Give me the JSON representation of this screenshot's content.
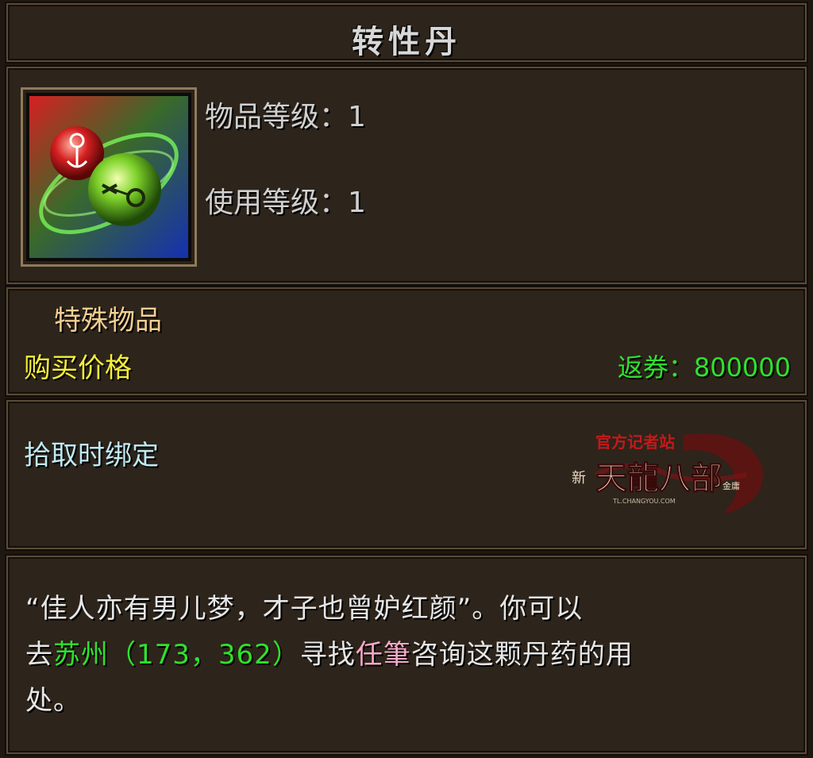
{
  "item": {
    "name": "转性丹",
    "item_level_label": "物品等级：",
    "item_level": "1",
    "use_level_label": "使用等级：",
    "use_level": "1",
    "item_type": "特殊物品",
    "price_label": "购买价格",
    "currency_label": "返券：",
    "currency_value": "800000",
    "bind_text": "拾取时绑定",
    "icon": "gender-swap-pill-icon"
  },
  "description": {
    "line1": "“佳人亦有男儿梦，才子也曾妒红颜”。你可以",
    "line2_pre": "去",
    "location": "苏州",
    "coords_open": "（",
    "coord_x": "173",
    "coord_sep": "，",
    "coord_y": "362",
    "coords_close": "）",
    "line2_mid": "寻找",
    "npc": "任筆",
    "line2_post": "咨询这颗丹药的用",
    "line3": "处。"
  },
  "watermark": {
    "top": "官方记者站",
    "prefix": "新",
    "title": "天龍八部",
    "suffix": "金庸",
    "url": "TL.CHANGYOU.COM"
  },
  "colors": {
    "title": "#d8d8d8",
    "item_type": "#f3cf93",
    "price_label": "#f5ee3a",
    "currency": "#2ee12e",
    "bind": "#bfeaf2",
    "location": "#2ee12e",
    "npc": "#f4a8c8"
  }
}
